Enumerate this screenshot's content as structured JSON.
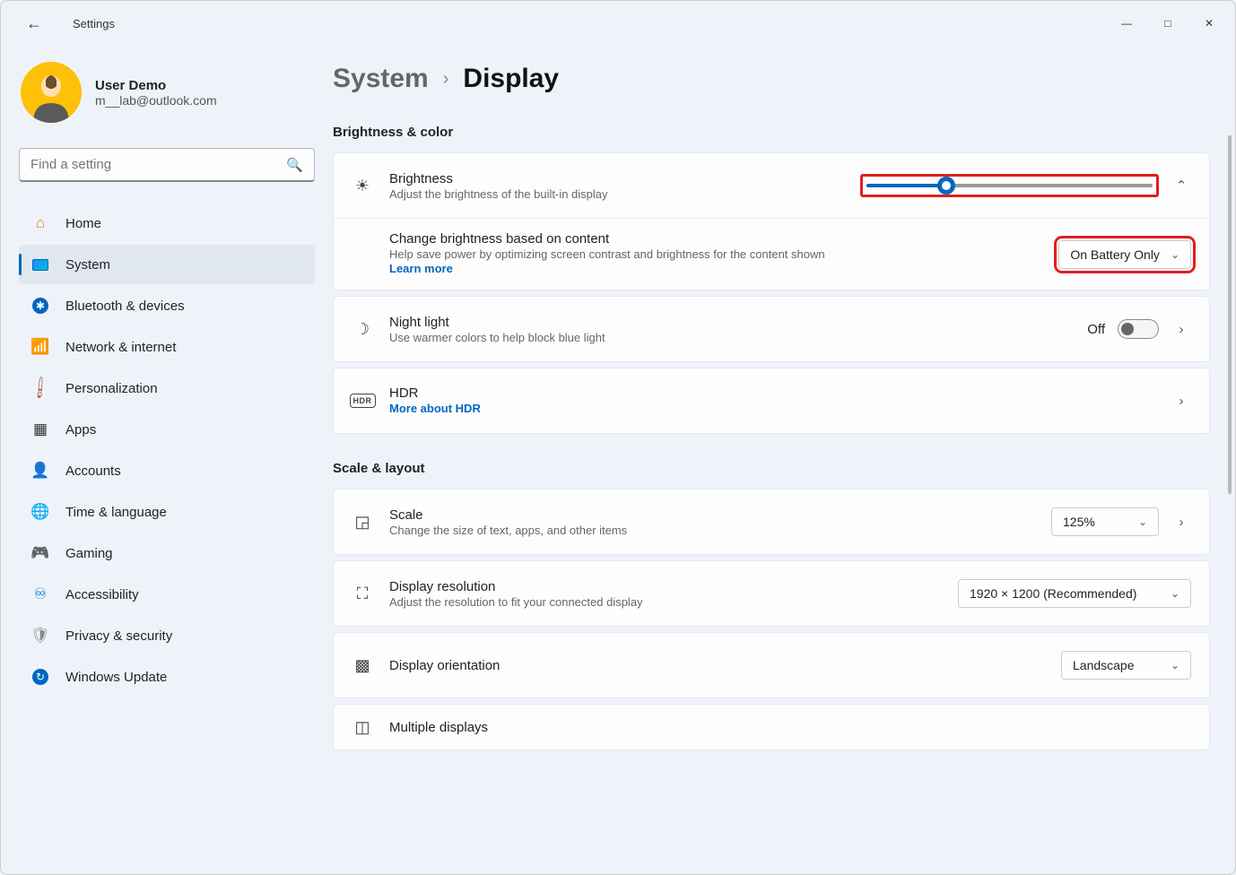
{
  "app": {
    "title": "Settings"
  },
  "user": {
    "name": "User Demo",
    "email": "m__lab@outlook.com"
  },
  "search": {
    "placeholder": "Find a setting"
  },
  "nav": {
    "items": [
      {
        "label": "Home"
      },
      {
        "label": "System"
      },
      {
        "label": "Bluetooth & devices"
      },
      {
        "label": "Network & internet"
      },
      {
        "label": "Personalization"
      },
      {
        "label": "Apps"
      },
      {
        "label": "Accounts"
      },
      {
        "label": "Time & language"
      },
      {
        "label": "Gaming"
      },
      {
        "label": "Accessibility"
      },
      {
        "label": "Privacy & security"
      },
      {
        "label": "Windows Update"
      }
    ],
    "active_index": 1
  },
  "breadcrumb": {
    "parent": "System",
    "current": "Display"
  },
  "sections": {
    "brightness_color": {
      "title": "Brightness & color",
      "brightness": {
        "title": "Brightness",
        "desc": "Adjust the brightness of the built-in display",
        "value_pct": 28
      },
      "adaptive": {
        "title": "Change brightness based on content",
        "desc": "Help save power by optimizing screen contrast and brightness for the content shown",
        "link": "Learn more",
        "dropdown_value": "On Battery Only"
      },
      "night_light": {
        "title": "Night light",
        "desc": "Use warmer colors to help block blue light",
        "state_label": "Off",
        "toggle_on": false
      },
      "hdr": {
        "title": "HDR",
        "link": "More about HDR",
        "badge": "HDR"
      }
    },
    "scale_layout": {
      "title": "Scale & layout",
      "scale": {
        "title": "Scale",
        "desc": "Change the size of text, apps, and other items",
        "value": "125%"
      },
      "resolution": {
        "title": "Display resolution",
        "desc": "Adjust the resolution to fit your connected display",
        "value": "1920 × 1200 (Recommended)"
      },
      "orientation": {
        "title": "Display orientation",
        "value": "Landscape"
      },
      "multiple": {
        "title": "Multiple displays"
      }
    }
  }
}
